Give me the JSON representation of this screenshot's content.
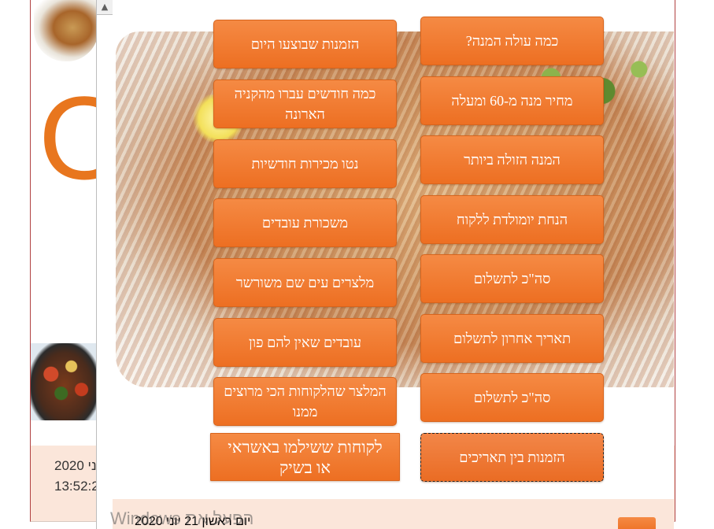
{
  "background_window": {
    "big_letter": "O",
    "date_fragment": "ני 2020",
    "time_fragment": "13:52:2"
  },
  "scrollbar": {
    "up_arrow": "▲",
    "icon": "scroll-up-arrow-icon"
  },
  "popup": {
    "left_buttons": [
      "הזמנות שבוצעו היום",
      "כמה חודשים עברו מהקניה הארונה",
      "נטו מכירות חודשיות",
      "משכורת עובדים",
      "מלצרים עים שם משורשר",
      "עובדים שאין להם פון",
      "המלצר שהלקוחות הכי מרוצים ממנו",
      "לקוחות ששילמו באשראי או בשיק"
    ],
    "right_buttons": [
      "כמה עולה המנה?",
      "מחיר מנה מ-60 ומעלה",
      "המנה הזולה ביותר",
      "הנחת יומולדת ללקוח",
      "סה\"כ לתשלום",
      "תאריך אחרון לתשלום",
      "סה\"כ לתשלום",
      "הזמנות בין תאריכים"
    ],
    "footer_date": "יום ראשון 21 יוני 2020",
    "watermark": "הפעל את Windows"
  }
}
